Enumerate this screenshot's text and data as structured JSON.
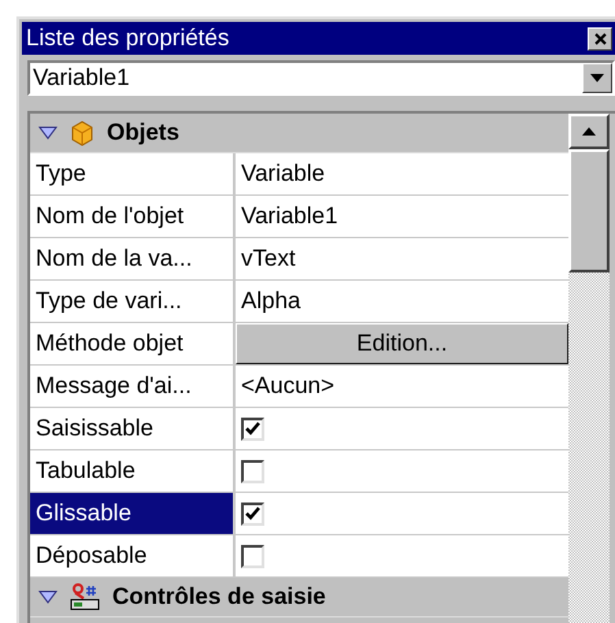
{
  "window": {
    "title": "Liste des propriétés"
  },
  "object_selector": {
    "value": "Variable1"
  },
  "sections": [
    {
      "title": "Objets",
      "kind": "objects",
      "expanded": true,
      "rows": [
        {
          "label": "Type",
          "kind": "text",
          "value": "Variable",
          "selected": false
        },
        {
          "label": "Nom de l'objet",
          "kind": "text",
          "value": "Variable1",
          "selected": false
        },
        {
          "label": "Nom de la va...",
          "kind": "text",
          "value": "vText",
          "selected": false
        },
        {
          "label": "Type de vari...",
          "kind": "text",
          "value": "Alpha",
          "selected": false
        },
        {
          "label": "Méthode objet",
          "kind": "button",
          "value": "Edition...",
          "selected": false
        },
        {
          "label": "Message d'ai...",
          "kind": "text",
          "value": "<Aucun>",
          "selected": false
        },
        {
          "label": "Saisissable",
          "kind": "checkbox",
          "checked": true,
          "selected": false
        },
        {
          "label": "Tabulable",
          "kind": "checkbox",
          "checked": false,
          "selected": false
        },
        {
          "label": "Glissable",
          "kind": "checkbox",
          "checked": true,
          "selected": true
        },
        {
          "label": "Déposable",
          "kind": "checkbox",
          "checked": false,
          "selected": false
        }
      ]
    },
    {
      "title": "Contrôles de saisie",
      "kind": "input-controls",
      "expanded": true
    }
  ]
}
